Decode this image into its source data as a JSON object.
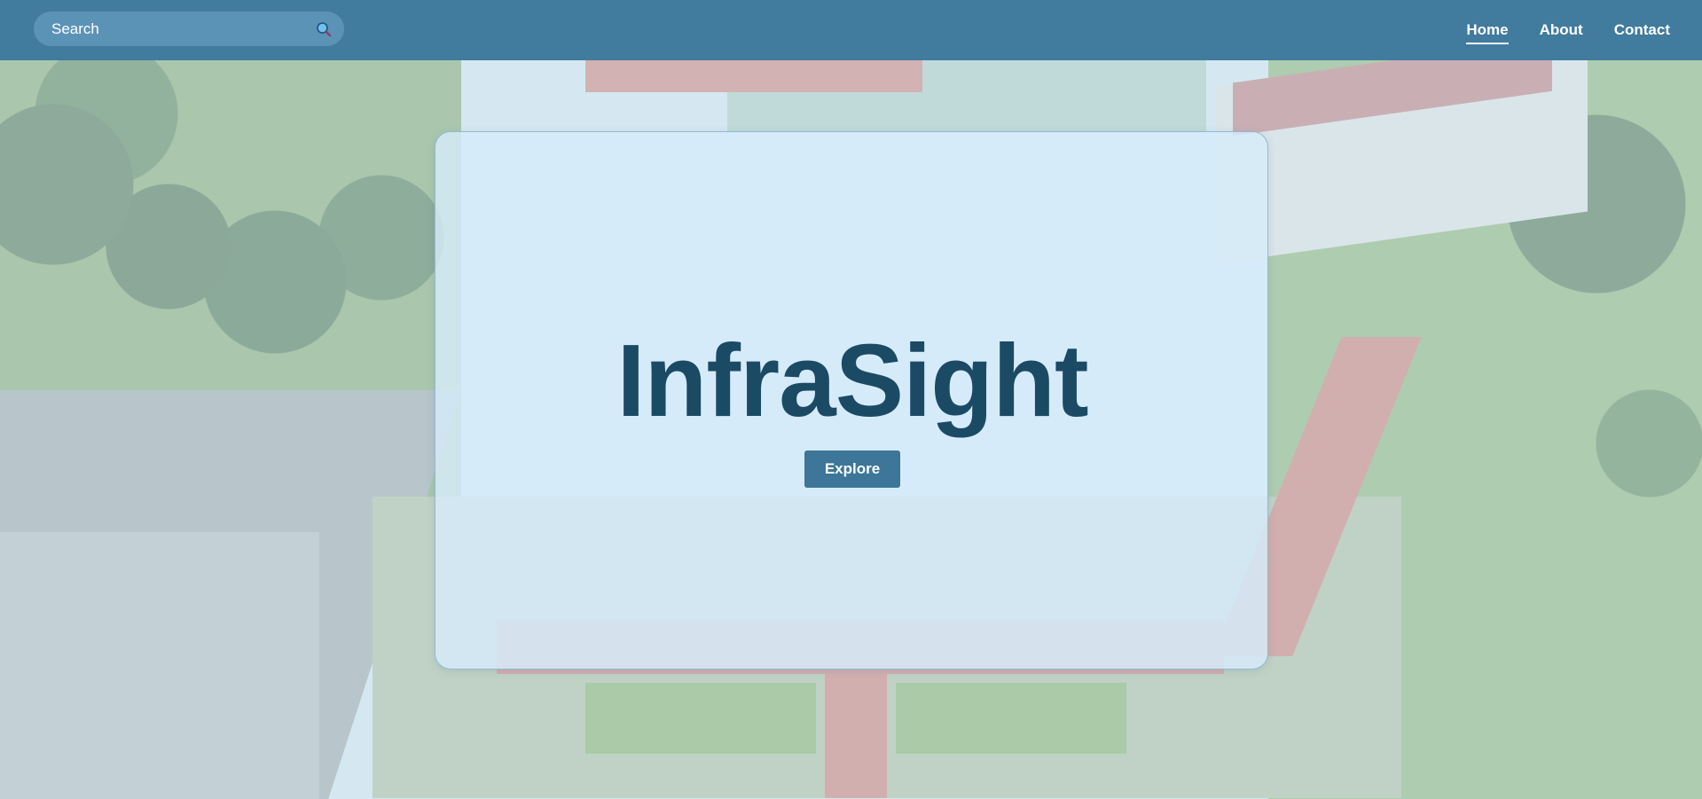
{
  "header": {
    "search": {
      "placeholder": "Search",
      "value": "",
      "icon": "search-icon"
    },
    "nav": [
      {
        "label": "Home",
        "active": true
      },
      {
        "label": "About",
        "active": false
      },
      {
        "label": "Contact",
        "active": false
      }
    ]
  },
  "hero": {
    "title": "InfraSight",
    "button_label": "Explore"
  },
  "colors": {
    "navbar": "#417b9e",
    "title": "#1b4a65",
    "button": "#3d7698",
    "card": "#d6ecfa"
  }
}
